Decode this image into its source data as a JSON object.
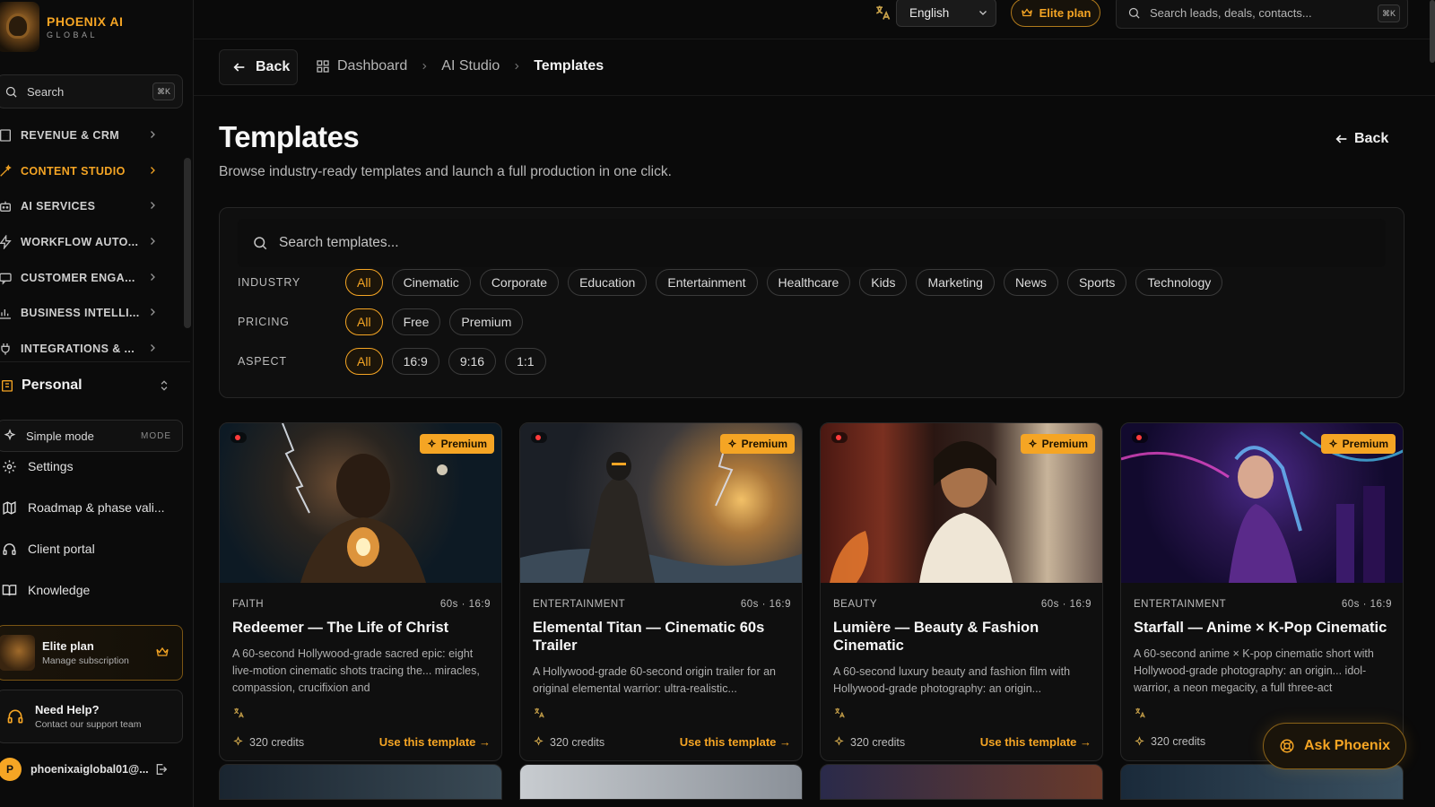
{
  "brand": {
    "name": "PHOENIX AI",
    "sub": "GLOBAL"
  },
  "sidebar": {
    "search_label": "Search",
    "search_kbd": "⌘K",
    "nav": [
      {
        "label": "REVENUE & CRM",
        "icon": "building-icon",
        "active": false
      },
      {
        "label": "CONTENT STUDIO",
        "icon": "wand-icon",
        "active": true
      },
      {
        "label": "AI SERVICES",
        "icon": "bot-icon",
        "active": false
      },
      {
        "label": "WORKFLOW AUTO...",
        "icon": "bolt-icon",
        "active": false
      },
      {
        "label": "CUSTOMER ENGA...",
        "icon": "chat-icon",
        "active": false
      },
      {
        "label": "BUSINESS INTELLI...",
        "icon": "bar-chart-icon",
        "active": false
      },
      {
        "label": "INTEGRATIONS & ...",
        "icon": "plug-icon",
        "active": false
      }
    ],
    "workspace": "Personal",
    "simple_mode": {
      "label": "Simple mode",
      "tag": "MODE"
    },
    "links": [
      {
        "label": "Settings",
        "icon": "gear-icon"
      },
      {
        "label": "Roadmap & phase vali...",
        "icon": "map-icon"
      },
      {
        "label": "Client portal",
        "icon": "headphones-icon"
      },
      {
        "label": "Knowledge",
        "icon": "book-icon"
      }
    ],
    "elite": {
      "title": "Elite plan",
      "subtitle": "Manage subscription"
    },
    "help": {
      "title": "Need Help?",
      "subtitle": "Contact our support team"
    },
    "user": {
      "initial": "P",
      "email": "phoenixaiglobal01@..."
    }
  },
  "topbar": {
    "language": "English",
    "plan_button": "Elite plan",
    "search_placeholder": "Search leads, deals, contacts...",
    "search_kbd": "⌘K"
  },
  "breadcrumb": {
    "back": "Back",
    "items": [
      "Dashboard",
      "AI Studio",
      "Templates"
    ]
  },
  "page": {
    "title": "Templates",
    "subtitle": "Browse industry-ready templates and launch a full production in one click.",
    "back": "Back"
  },
  "filters": {
    "search_placeholder": "Search templates...",
    "industry": {
      "label": "INDUSTRY",
      "options": [
        "All",
        "Cinematic",
        "Corporate",
        "Education",
        "Entertainment",
        "Healthcare",
        "Kids",
        "Marketing",
        "News",
        "Sports",
        "Technology"
      ],
      "selected": "All"
    },
    "pricing": {
      "label": "PRICING",
      "options": [
        "All",
        "Free",
        "Premium"
      ],
      "selected": "All"
    },
    "aspect": {
      "label": "ASPECT",
      "options": [
        "All",
        "16:9",
        "9:16",
        "1:1"
      ],
      "selected": "All"
    }
  },
  "cards": [
    {
      "badge": "Premium",
      "category": "FAITH",
      "meta": "60s · 16:9",
      "title": "Redeemer — The Life of Christ",
      "description": "A 60-second Hollywood-grade sacred epic: eight live-motion cinematic shots tracing the... miracles, compassion, crucifixion and",
      "credits": "320 credits",
      "cta": "Use this template →"
    },
    {
      "badge": "Premium",
      "category": "ENTERTAINMENT",
      "meta": "60s · 16:9",
      "title": "Elemental Titan — Cinematic 60s Trailer",
      "description": "A Hollywood-grade 60-second origin trailer for an original elemental warrior: ultra-realistic...",
      "credits": "320 credits",
      "cta": "Use this template →"
    },
    {
      "badge": "Premium",
      "category": "BEAUTY",
      "meta": "60s · 16:9",
      "title": "Lumière — Beauty & Fashion Cinematic",
      "description": "A 60-second luxury beauty and fashion film with Hollywood-grade photography: an origin...",
      "credits": "320 credits",
      "cta": "Use this template →"
    },
    {
      "badge": "Premium",
      "category": "ENTERTAINMENT",
      "meta": "60s · 16:9",
      "title": "Starfall — Anime × K-Pop Cinematic",
      "description": "A 60-second anime × K-pop cinematic short with Hollywood-grade photography: an origin... idol-warrior, a neon megacity, a full three-act",
      "credits": "320 credits",
      "cta": ""
    }
  ],
  "ask_button": "Ask Phoenix",
  "colors": {
    "accent": "#f5a524",
    "background": "#0a0a0a",
    "card": "#0f0f0f",
    "border": "#262626"
  }
}
